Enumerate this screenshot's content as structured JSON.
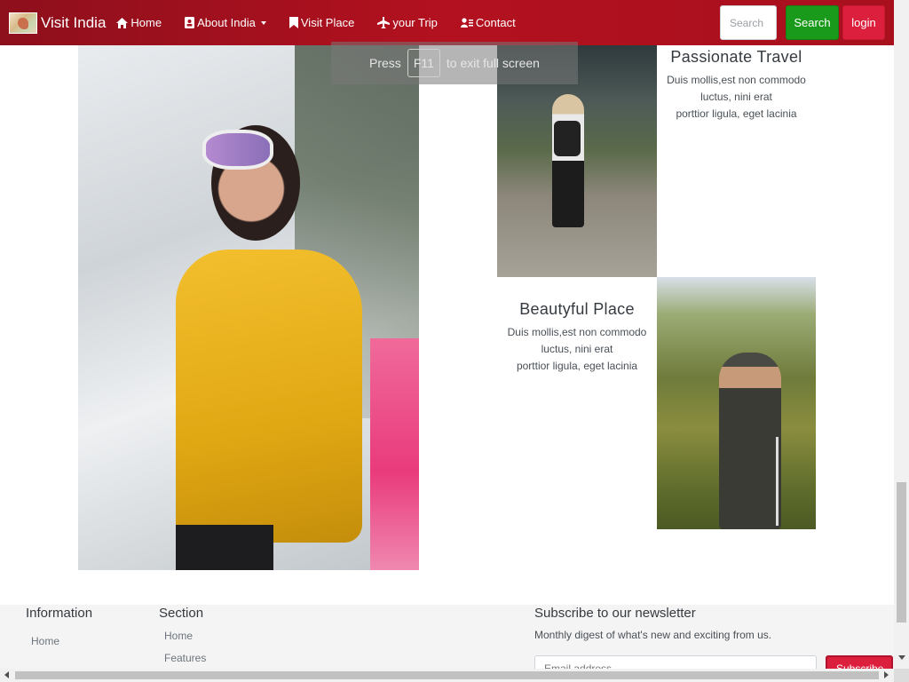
{
  "navbar": {
    "brand": "Visit India",
    "items": [
      {
        "label": "Home",
        "icon": "home-icon"
      },
      {
        "label": "About India",
        "icon": "id-card-icon",
        "dropdown": true
      },
      {
        "label": "Visit Place",
        "icon": "bookmark-icon"
      },
      {
        "label": "your Trip",
        "icon": "plane-icon"
      },
      {
        "label": "Contact",
        "icon": "contact-icon"
      }
    ],
    "search_placeholder": "Search",
    "search_button": "Search",
    "login_button": "login",
    "colors": {
      "bar": "#a8101d",
      "search": "#1a9a1a",
      "login": "#dc1f3c"
    }
  },
  "fullscreen_notice": {
    "before": "Press",
    "key": "F11",
    "after": "to exit full screen"
  },
  "cards": [
    {
      "title": "Passionate Travel",
      "line1": "Duis mollis,est non commodo",
      "line2": "luctus, nini erat",
      "line3": "porttior ligula, eget lacinia"
    },
    {
      "title": "Beautyful Place",
      "line1": "Duis mollis,est non commodo",
      "line2": "luctus, nini erat",
      "line3": "porttior ligula, eget lacinia"
    }
  ],
  "footer": {
    "info": {
      "heading": "Information",
      "links": [
        "Home"
      ]
    },
    "section": {
      "heading": "Section",
      "links": [
        "Home",
        "Features"
      ]
    },
    "newsletter": {
      "heading": "Subscribe to our newsletter",
      "subtitle": "Monthly digest of what's new and exciting from us.",
      "email_placeholder": "Email address",
      "button": "Subscribe"
    }
  }
}
